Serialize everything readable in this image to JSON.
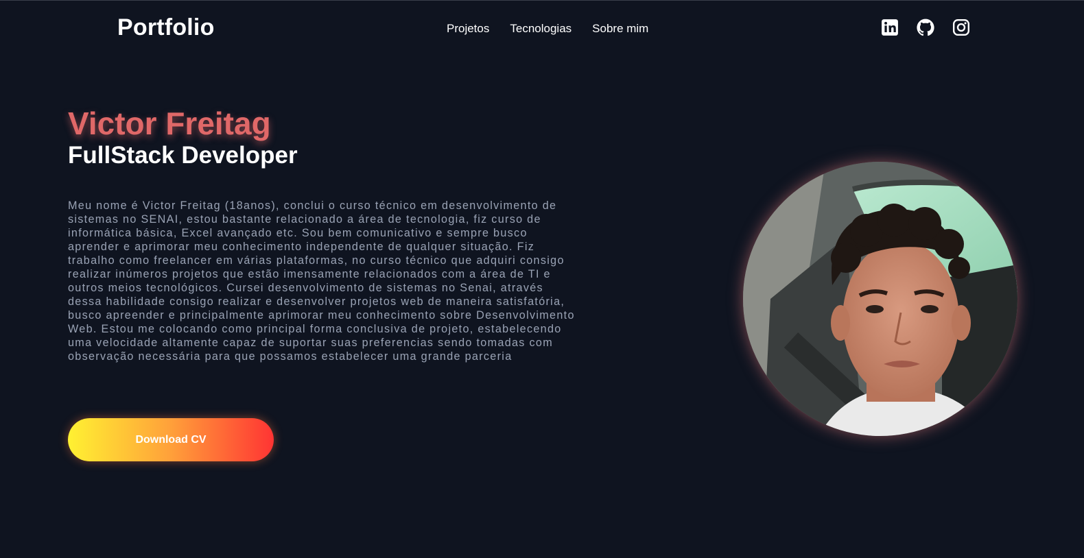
{
  "header": {
    "brand": "Portfolio",
    "nav": [
      {
        "label": "Projetos"
      },
      {
        "label": "Tecnologias"
      },
      {
        "label": "Sobre mim"
      }
    ],
    "social": [
      "linkedin-icon",
      "github-icon",
      "instagram-icon"
    ]
  },
  "hero": {
    "name": "Victor Freitag",
    "role": "FullStack Developer",
    "bio": "Meu nome é Victor Freitag (18anos), conclui o curso técnico em desenvolvimento de sistemas no SENAI, estou bastante relacionado a área de tecnologia, fiz curso de informática básica, Excel avançado etc. Sou bem comunicativo e sempre busco aprender e aprimorar meu conhecimento independente de qualquer situação. Fiz trabalho como freelancer em várias plataformas, no curso técnico que adquiri consigo realizar inúmeros projetos que estão imensamente relacionados com a área de TI e outros meios tecnológicos. Cursei desenvolvimento de sistemas no Senai, através dessa habilidade consigo realizar e desenvolver projetos web de maneira satisfatória, busco apreender e principalmente aprimorar meu conhecimento sobre Desenvolvimento Web. Estou me colocando como principal forma conclusiva de projeto, estabelecendo uma velocidade altamente capaz de suportar suas preferencias sendo tomadas com observação necessária para que possamos estabelecer uma grande parceria",
    "cv_button": "Download CV"
  },
  "colors": {
    "background": "#0f1420",
    "name_accent": "#e06868",
    "bio_text": "#9aa3b5",
    "button_gradient": [
      "#fff132",
      "#ffa03a",
      "#ff3433"
    ]
  }
}
